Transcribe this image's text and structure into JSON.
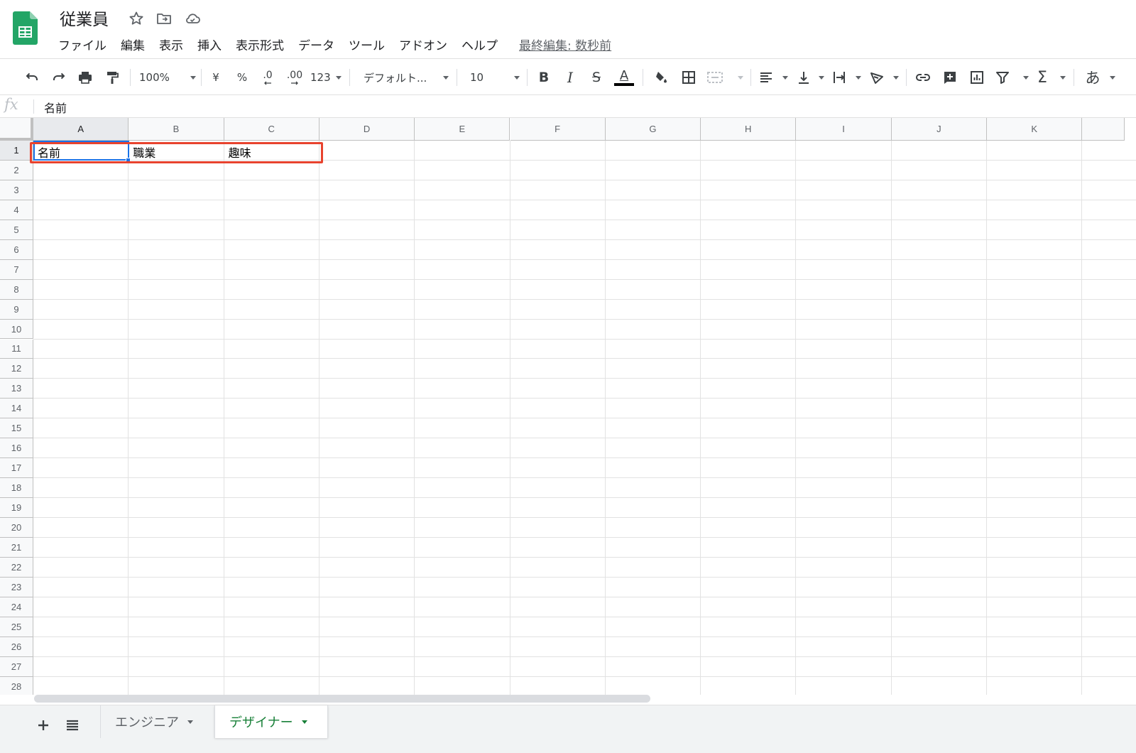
{
  "app": {
    "title": "従業員",
    "last_edit": "最終編集: 数秒前",
    "brand_color": "#0f9d58"
  },
  "menu": [
    "ファイル",
    "編集",
    "表示",
    "挿入",
    "表示形式",
    "データ",
    "ツール",
    "アドオン",
    "ヘルプ"
  ],
  "toolbar": {
    "zoom": "100%",
    "currency": "¥",
    "percent": "%",
    "decimal_decrease": ".0",
    "decimal_increase": ".00",
    "number_format": "123",
    "font": "デフォルト...",
    "font_size": "10",
    "input_tools": "あ"
  },
  "formula": {
    "fx_label": "fx",
    "value": "名前"
  },
  "columns": [
    "A",
    "B",
    "C",
    "D",
    "E",
    "F",
    "G",
    "H",
    "I",
    "J",
    "K"
  ],
  "rows": [
    "1",
    "2",
    "3",
    "4",
    "5",
    "6",
    "7",
    "8",
    "9",
    "10",
    "11",
    "12",
    "13",
    "14",
    "15",
    "16",
    "17",
    "18",
    "19",
    "20",
    "21",
    "22",
    "23",
    "24",
    "25",
    "26",
    "27",
    "28"
  ],
  "cells": {
    "A1": "名前",
    "B1": "職業",
    "C1": "趣味"
  },
  "active_cell": "A1",
  "sheets": [
    {
      "name": "エンジニア",
      "active": false
    },
    {
      "name": "デザイナー",
      "active": true
    }
  ],
  "colors": {
    "selection": "#1a73e8",
    "highlight": "#e8432e",
    "active_tab": "#188038"
  }
}
